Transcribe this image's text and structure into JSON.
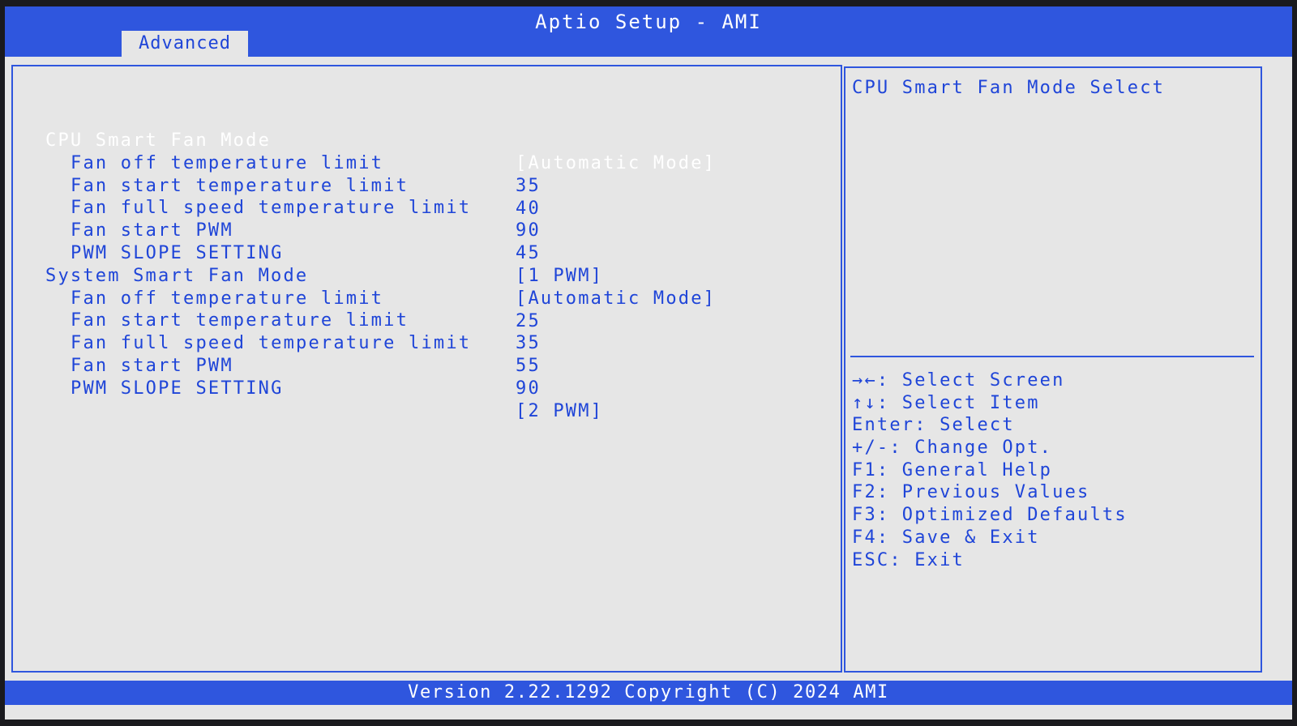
{
  "header": {
    "title": "Aptio Setup - AMI",
    "active_tab": "Advanced"
  },
  "settings": [
    {
      "label": "CPU Smart Fan Mode",
      "value": "[Automatic Mode]",
      "selected": true
    },
    {
      "label": "Fan off temperature limit",
      "value": "35"
    },
    {
      "label": "Fan start temperature limit",
      "value": "40"
    },
    {
      "label": "Fan full speed temperature limit",
      "value": "90"
    },
    {
      "label": "Fan start PWM",
      "value": "45"
    },
    {
      "label": "PWM SLOPE SETTING",
      "value": "[1 PWM]"
    },
    {
      "label": "System Smart Fan Mode",
      "value": "[Automatic Mode]"
    },
    {
      "label": "Fan off temperature limit",
      "value": "25"
    },
    {
      "label": "Fan start temperature limit",
      "value": "35"
    },
    {
      "label": "Fan full speed temperature limit",
      "value": "55"
    },
    {
      "label": "Fan start PWM",
      "value": "90"
    },
    {
      "label": "PWM SLOPE SETTING",
      "value": "[2 PWM]"
    }
  ],
  "help": {
    "text": "CPU Smart Fan Mode Select"
  },
  "key_legend": [
    "→←: Select Screen",
    "↑↓: Select Item",
    "Enter: Select",
    "+/-: Change Opt.",
    "F1: General Help",
    "F2: Previous Values",
    "F3: Optimized Defaults",
    "F4: Save & Exit",
    "ESC: Exit"
  ],
  "footer": {
    "version": "Version 2.22.1292 Copyright (C) 2024 AMI"
  },
  "colors": {
    "accent": "#2f56de",
    "text": "#1f45d8",
    "background": "#e6e6e6",
    "highlight_text": "#ffffff"
  }
}
